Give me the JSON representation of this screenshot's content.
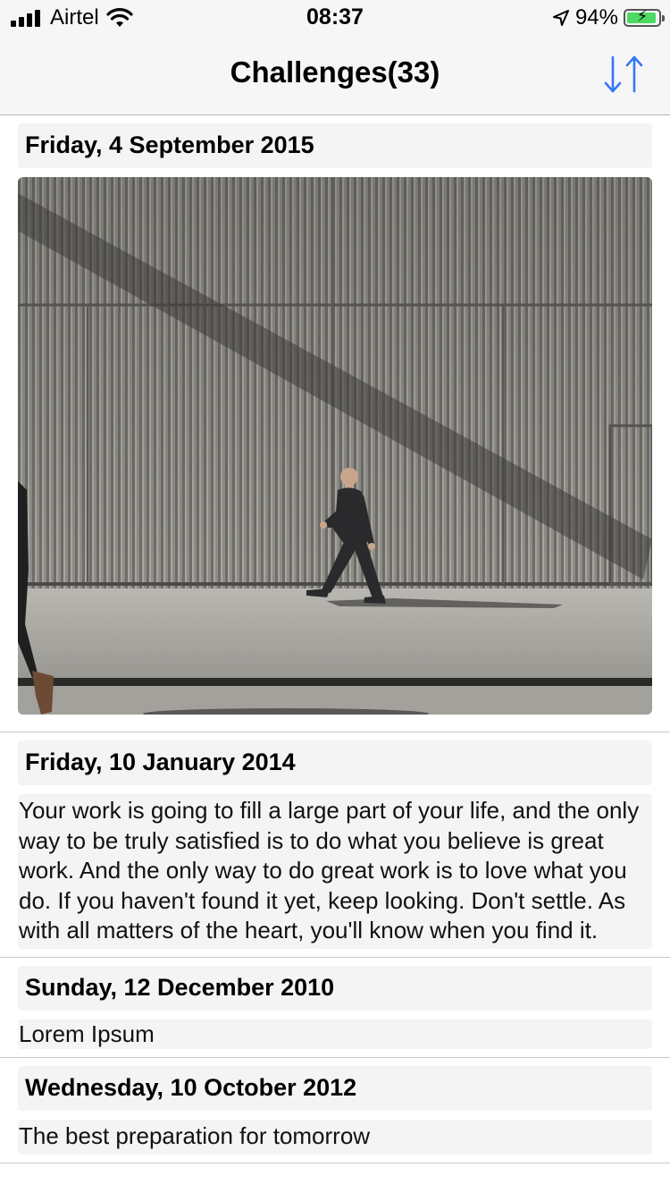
{
  "status_bar": {
    "carrier": "Airtel",
    "time": "08:37",
    "battery_percent": "94%",
    "battery_level": 0.94,
    "icons": [
      "signal-bars-icon",
      "wifi-icon",
      "location-arrow-icon",
      "battery-charging-icon"
    ]
  },
  "nav": {
    "title": "Challenges(33)",
    "sort_icon": "sort-arrows-icon",
    "accent_color": "#3478f6"
  },
  "feed": {
    "items": [
      {
        "date": "Friday, 4 September 2015",
        "type": "image",
        "image": "man-walking-past-corrugated-wall"
      },
      {
        "date": "Friday, 10 January 2014",
        "type": "text",
        "text": "Your work is going to fill a large part of your life, and the only way to be truly satisfied is to do what you believe is great work. And the only way to do great work is to love what you do. If you haven't found it yet, keep looking. Don't settle. As with all matters of the heart, you'll know when you find it."
      },
      {
        "date": "Sunday, 12 December 2010",
        "type": "text",
        "text": "Lorem Ipsum"
      },
      {
        "date": "Wednesday, 10 October 2012",
        "type": "text",
        "text": "The best preparation for tomorrow"
      }
    ]
  }
}
